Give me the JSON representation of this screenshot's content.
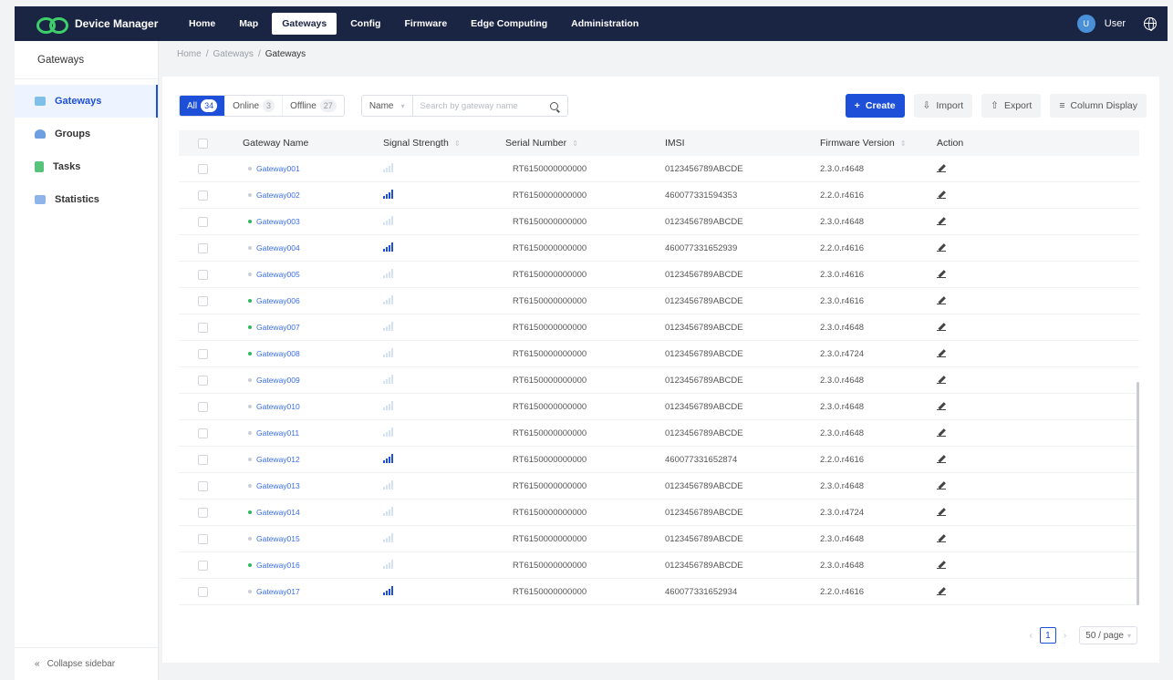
{
  "brand": {
    "name": "Device Manager"
  },
  "nav": [
    "Home",
    "Map",
    "Gateways",
    "Config",
    "Firmware",
    "Edge Computing",
    "Administration"
  ],
  "nav_active": "Gateways",
  "user": {
    "name": "User",
    "avatar_initial": "U"
  },
  "sidebar": {
    "title": "Gateways",
    "items": [
      {
        "label": "Gateways",
        "icon": "gateway-icon",
        "color": "#7fbfe8",
        "active": true
      },
      {
        "label": "Groups",
        "icon": "groups-icon",
        "color": "#6e9fe0",
        "active": false
      },
      {
        "label": "Tasks",
        "icon": "tasks-icon",
        "color": "#57c27a",
        "active": false
      },
      {
        "label": "Statistics",
        "icon": "statistics-icon",
        "color": "#8fb4ea",
        "active": false
      }
    ],
    "collapse_label": "Collapse sidebar",
    "collapse_arrow": "«"
  },
  "breadcrumb": {
    "items": [
      "Home",
      "Gateways",
      "Gateways"
    ],
    "separator": "/"
  },
  "filters": {
    "all_label": "All",
    "all_count": "34",
    "online_label": "Online",
    "online_count": "3",
    "offline_label": "Offline",
    "offline_count": "27"
  },
  "search": {
    "field": "Name",
    "field_arrow": "▾",
    "placeholder": "Search by gateway name"
  },
  "actions": {
    "create_label": "Create",
    "create_icon": "+",
    "import_label": "Import",
    "import_icon": "⇩",
    "export_label": "Export",
    "export_icon": "⇧",
    "columns_label": "Column Display",
    "columns_icon": "≡"
  },
  "table": {
    "sort_glyph": "⇕",
    "columns": {
      "name": "Gateway Name",
      "signal": "Signal Strength",
      "serial": "Serial Number",
      "imsi": "IMSI",
      "firmware": "Firmware Version",
      "action": "Action"
    },
    "rows": [
      {
        "name": "Gateway001",
        "online": false,
        "signal": "weak",
        "serial": "RT6150000000000",
        "imsi": "0123456789ABCDE",
        "firmware": "2.3.0.r4648"
      },
      {
        "name": "Gateway002",
        "online": false,
        "signal": "strong",
        "serial": "RT6150000000000",
        "imsi": "460077331594353",
        "firmware": "2.2.0.r4616"
      },
      {
        "name": "Gateway003",
        "online": true,
        "signal": "weak",
        "serial": "RT6150000000000",
        "imsi": "0123456789ABCDE",
        "firmware": "2.3.0.r4648"
      },
      {
        "name": "Gateway004",
        "online": false,
        "signal": "strong",
        "serial": "RT6150000000000",
        "imsi": "460077331652939",
        "firmware": "2.2.0.r4616"
      },
      {
        "name": "Gateway005",
        "online": false,
        "signal": "weak",
        "serial": "RT6150000000000",
        "imsi": "0123456789ABCDE",
        "firmware": "2.3.0.r4616"
      },
      {
        "name": "Gateway006",
        "online": true,
        "signal": "weak",
        "serial": "RT6150000000000",
        "imsi": "0123456789ABCDE",
        "firmware": "2.3.0.r4616"
      },
      {
        "name": "Gateway007",
        "online": true,
        "signal": "weak",
        "serial": "RT6150000000000",
        "imsi": "0123456789ABCDE",
        "firmware": "2.3.0.r4648"
      },
      {
        "name": "Gateway008",
        "online": true,
        "signal": "weak",
        "serial": "RT6150000000000",
        "imsi": "0123456789ABCDE",
        "firmware": "2.3.0.r4724"
      },
      {
        "name": "Gateway009",
        "online": false,
        "signal": "weak",
        "serial": "RT6150000000000",
        "imsi": "0123456789ABCDE",
        "firmware": "2.3.0.r4648"
      },
      {
        "name": "Gateway010",
        "online": false,
        "signal": "weak",
        "serial": "RT6150000000000",
        "imsi": "0123456789ABCDE",
        "firmware": "2.3.0.r4648"
      },
      {
        "name": "Gateway011",
        "online": false,
        "signal": "weak",
        "serial": "RT6150000000000",
        "imsi": "0123456789ABCDE",
        "firmware": "2.3.0.r4648"
      },
      {
        "name": "Gateway012",
        "online": false,
        "signal": "strong",
        "serial": "RT6150000000000",
        "imsi": "460077331652874",
        "firmware": "2.2.0.r4616"
      },
      {
        "name": "Gateway013",
        "online": false,
        "signal": "weak",
        "serial": "RT6150000000000",
        "imsi": "0123456789ABCDE",
        "firmware": "2.3.0.r4648"
      },
      {
        "name": "Gateway014",
        "online": true,
        "signal": "weak",
        "serial": "RT6150000000000",
        "imsi": "0123456789ABCDE",
        "firmware": "2.3.0.r4724"
      },
      {
        "name": "Gateway015",
        "online": false,
        "signal": "weak",
        "serial": "RT6150000000000",
        "imsi": "0123456789ABCDE",
        "firmware": "2.3.0.r4648"
      },
      {
        "name": "Gateway016",
        "online": true,
        "signal": "weak",
        "serial": "RT6150000000000",
        "imsi": "0123456789ABCDE",
        "firmware": "2.3.0.r4648"
      },
      {
        "name": "Gateway017",
        "online": false,
        "signal": "strong",
        "serial": "RT6150000000000",
        "imsi": "460077331652934",
        "firmware": "2.2.0.r4616"
      }
    ]
  },
  "pagination": {
    "prev": "‹",
    "next": "›",
    "current_page": "1",
    "page_size": "50 / page",
    "page_size_arrow": "▾"
  },
  "colors": {
    "nav_bg": "#1a2544",
    "primary": "#1d4fd8",
    "online": "#2eb85c",
    "brand_logo": "#3ecf6a",
    "link": "#3a6ee8"
  }
}
